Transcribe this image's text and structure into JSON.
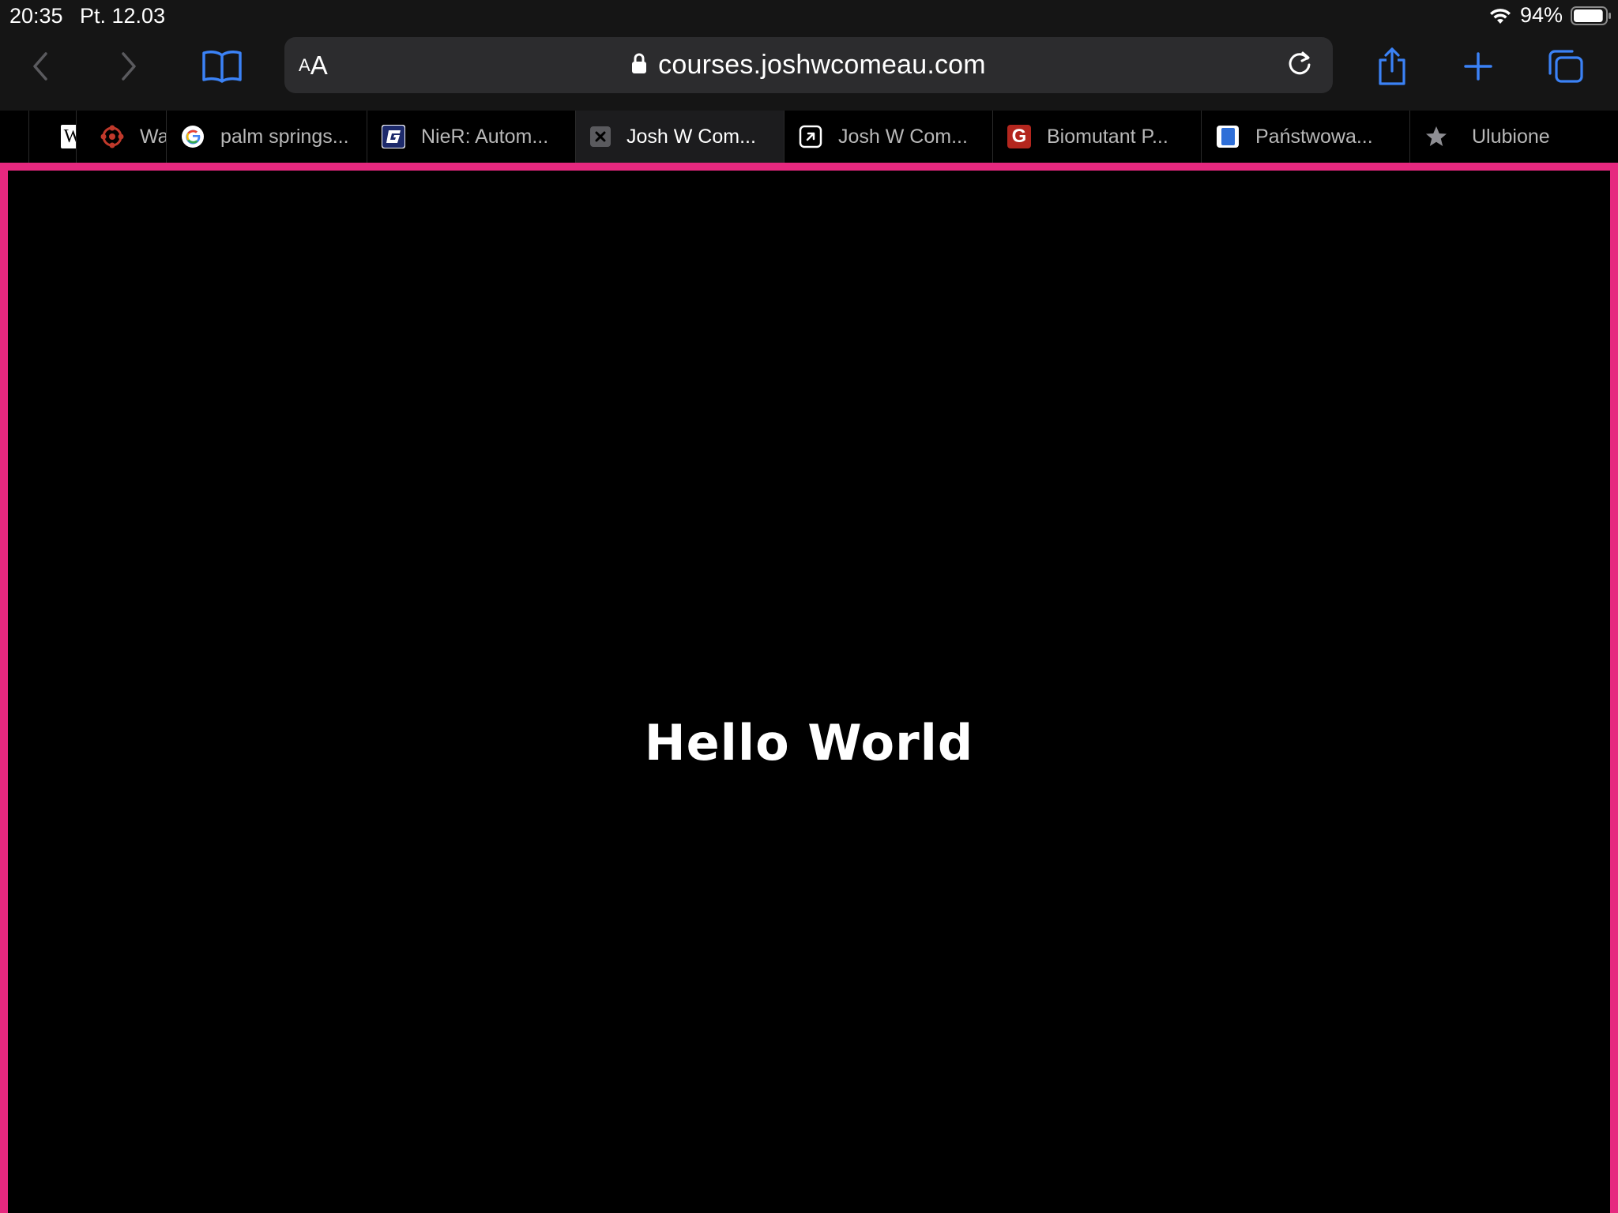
{
  "status_bar": {
    "time": "20:35",
    "date": "Pt. 12.03",
    "battery": "94%",
    "battery_level": 0.94
  },
  "toolbar": {
    "url": "courses.joshwcomeau.com",
    "text_size_small": "A",
    "text_size_big": "A",
    "accent_color": "#3b82f6"
  },
  "tabs": [
    {
      "label": "",
      "icon": "wikipedia-icon"
    },
    {
      "label": "Wa",
      "icon": "ign-icon"
    },
    {
      "label": "palm springs...",
      "icon": "google-icon"
    },
    {
      "label": "NieR: Autom...",
      "icon": "gamefaqs-icon"
    },
    {
      "label": "Josh W Com...",
      "icon": "close-icon",
      "active": true
    },
    {
      "label": "Josh W Com...",
      "icon": "external-link-icon"
    },
    {
      "label": "Biomutant P...",
      "icon": "g-red-icon"
    },
    {
      "label": "Państwowa...",
      "icon": "blue-book-icon"
    },
    {
      "label": "Ulubione",
      "icon": "star-icon"
    }
  ],
  "page": {
    "heading": "Hello World",
    "border_color": "#e6287f"
  }
}
